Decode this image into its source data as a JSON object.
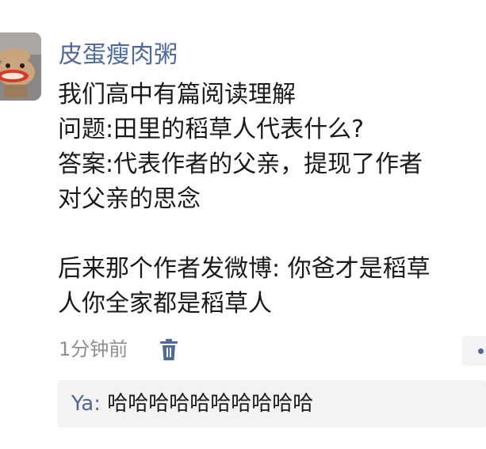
{
  "post": {
    "avatar_icon": "toy-figure-avatar",
    "username": "皮蛋瘦肉粥",
    "text": "我们高中有篇阅读理解\n问题:田里的稻草人代表什么?\n答案:代表作者的父亲，提现了作者\n对父亲的思念\n\n后来那个作者发微博: 你爸才是稻草\n人你全家都是稻草人",
    "time": "1分钟前",
    "delete_icon": "trash-icon",
    "more_icon": "more-dots-icon"
  },
  "comment": {
    "author": "Ya",
    "separator": ": ",
    "text": "哈哈哈哈哈哈哈哈哈哈"
  },
  "colors": {
    "link": "#506a98",
    "text": "#1a1a1a",
    "muted": "#8e8e8e",
    "panel": "#f3f3f3"
  }
}
